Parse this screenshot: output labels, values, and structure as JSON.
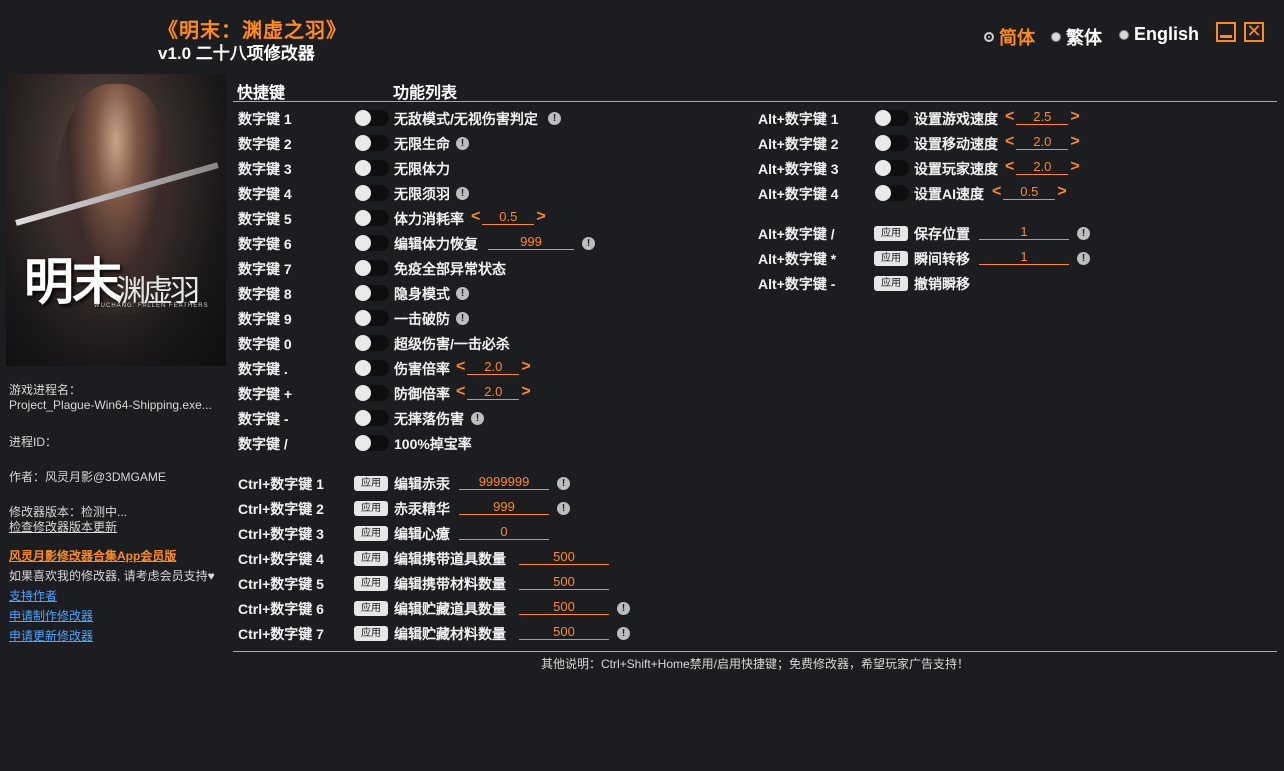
{
  "app": {
    "title": "《明末：渊虚之羽》",
    "subtitle": "v1.0 二十八项修改器"
  },
  "languages": [
    {
      "label": "简体",
      "selected": true
    },
    {
      "label": "繁体",
      "selected": false
    },
    {
      "label": "English",
      "selected": false
    }
  ],
  "colors": {
    "accent": "#ff8a1e",
    "background": "#1c1d20",
    "link": "#4ea3ff"
  },
  "cover": {
    "logo_main": "明末",
    "logo_sub": "渊虚羽",
    "logo_en": "WUCHANG: FALLEN FEATHERS"
  },
  "sidebar": {
    "process_label": "游戏进程名：",
    "process_value": "Project_Plague-Win64-Shipping.exe...",
    "pid_label": "进程ID：",
    "author": "作者：风灵月影@3DMGAME",
    "version": "修改器版本：检测中...",
    "check_update": "检查修改器版本更新",
    "promo": "风灵月影修改器合集App会员版",
    "support_note": "如果喜欢我的修改器, 请考虑会员支持♥",
    "support_link": "支持作者",
    "request_make": "申请制作修改器",
    "request_update": "申请更新修改器"
  },
  "headers": {
    "hotkey": "快捷键",
    "features": "功能列表"
  },
  "left_features": [
    {
      "key": "数字键 1",
      "name": "无敌模式/无视伤害判定",
      "info": true
    },
    {
      "key": "数字键 2",
      "name": "无限生命",
      "info": true
    },
    {
      "key": "数字键 3",
      "name": "无限体力"
    },
    {
      "key": "数字键 4",
      "name": "无限须羽",
      "info": true
    },
    {
      "key": "数字键 5",
      "name": "体力消耗率",
      "stepper": "0.5"
    },
    {
      "key": "数字键 6",
      "name": "编辑体力恢复",
      "field": "999",
      "info": true
    },
    {
      "key": "数字键 7",
      "name": "免疫全部异常状态"
    },
    {
      "key": "数字键 8",
      "name": "隐身模式",
      "info": true
    },
    {
      "key": "数字键 9",
      "name": "一击破防",
      "info": true
    },
    {
      "key": "数字键 0",
      "name": "超级伤害/一击必杀"
    },
    {
      "key": "数字键 .",
      "name": "伤害倍率",
      "stepper": "2.0"
    },
    {
      "key": "数字键 +",
      "name": "防御倍率",
      "stepper": "2.0"
    },
    {
      "key": "数字键 -",
      "name": "无摔落伤害",
      "info": true
    },
    {
      "key": "数字键 /",
      "name": "100%掉宝率"
    }
  ],
  "ctrl_features": [
    {
      "key": "Ctrl+数字键 1",
      "apply": "应用",
      "name": "编辑赤汞",
      "field": "9999999",
      "info": true
    },
    {
      "key": "Ctrl+数字键 2",
      "apply": "应用",
      "name": "赤汞精华",
      "field": "999",
      "info": true
    },
    {
      "key": "Ctrl+数字键 3",
      "apply": "应用",
      "name": "编辑心癔",
      "field": "0"
    },
    {
      "key": "Ctrl+数字键 4",
      "apply": "应用",
      "name": "编辑携带道具数量",
      "field": "500"
    },
    {
      "key": "Ctrl+数字键 5",
      "apply": "应用",
      "name": "编辑携带材料数量",
      "field": "500"
    },
    {
      "key": "Ctrl+数字键 6",
      "apply": "应用",
      "name": "编辑贮藏道具数量",
      "field": "500",
      "info": true
    },
    {
      "key": "Ctrl+数字键 7",
      "apply": "应用",
      "name": "编辑贮藏材料数量",
      "field": "500",
      "info": true
    }
  ],
  "alt_speed": [
    {
      "key": "Alt+数字键 1",
      "name": "设置游戏速度",
      "stepper": "2.5"
    },
    {
      "key": "Alt+数字键 2",
      "name": "设置移动速度",
      "stepper": "2.0"
    },
    {
      "key": "Alt+数字键 3",
      "name": "设置玩家速度",
      "stepper": "2.0"
    },
    {
      "key": "Alt+数字键 4",
      "name": "设置AI速度",
      "stepper": "0.5"
    }
  ],
  "alt_teleport": [
    {
      "key": "Alt+数字键 /",
      "apply": "应用",
      "name": "保存位置",
      "field": "1",
      "info": true
    },
    {
      "key": "Alt+数字键 *",
      "apply": "应用",
      "name": "瞬间转移",
      "field": "1",
      "info": true
    },
    {
      "key": "Alt+数字键 -",
      "apply": "应用",
      "name": "撤销瞬移"
    }
  ],
  "steppers": {
    "left_arrow": "<",
    "right_arrow": ">"
  },
  "info_icon": "!",
  "footer": "其他说明：Ctrl+Shift+Home禁用/启用快捷键；免费修改器，希望玩家广告支持！"
}
